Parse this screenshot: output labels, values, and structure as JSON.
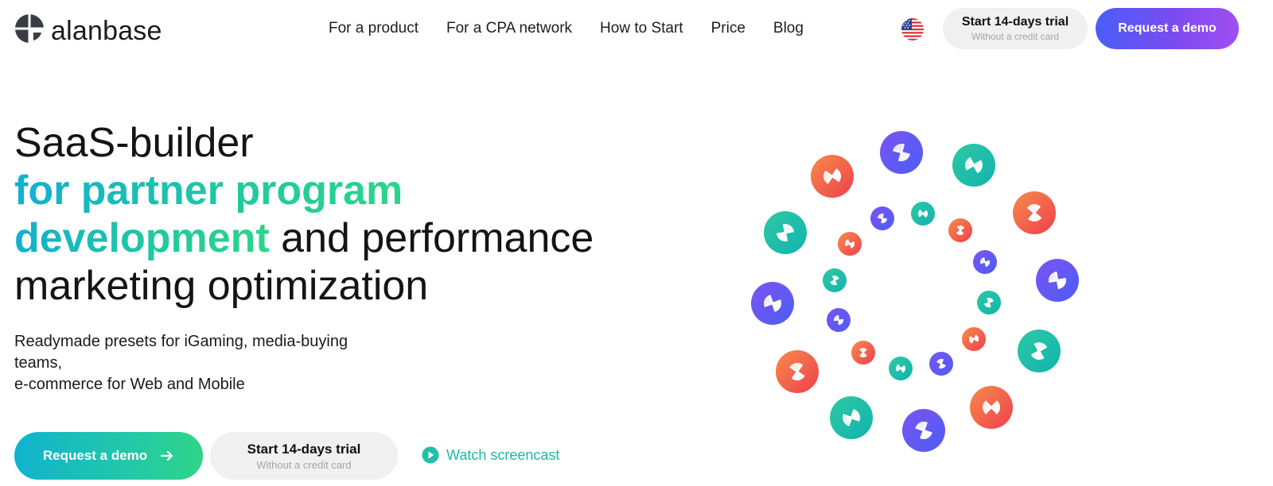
{
  "header": {
    "logo_text": "alanbase",
    "nav": [
      "For a product",
      "For a CPA network",
      "How to Start",
      "Price",
      "Blog"
    ],
    "language_flag": "us-flag-icon",
    "trial_button": {
      "title": "Start 14-days trial",
      "subtitle": "Without a credit card"
    },
    "demo_button": "Request a demo"
  },
  "hero": {
    "title_line1": "SaaS-builder",
    "title_line2": "for partner program",
    "title_line3_highlight": "development",
    "title_line3_rest": " and performance",
    "title_line4": "marketing optimization",
    "subtitle_lines": [
      "Readymade presets for iGaming, media-buying",
      "teams,",
      "e-commerce for Web and Mobile"
    ],
    "cta_demo": "Request a demo",
    "cta_trial": {
      "title": "Start 14-days trial",
      "subtitle": "Without a credit card"
    },
    "watch_label": "Watch screencast"
  },
  "colors": {
    "brand_purple": "#5b57f5",
    "brand_teal": "#1fbfa8",
    "brand_orange": "#f5663f"
  }
}
